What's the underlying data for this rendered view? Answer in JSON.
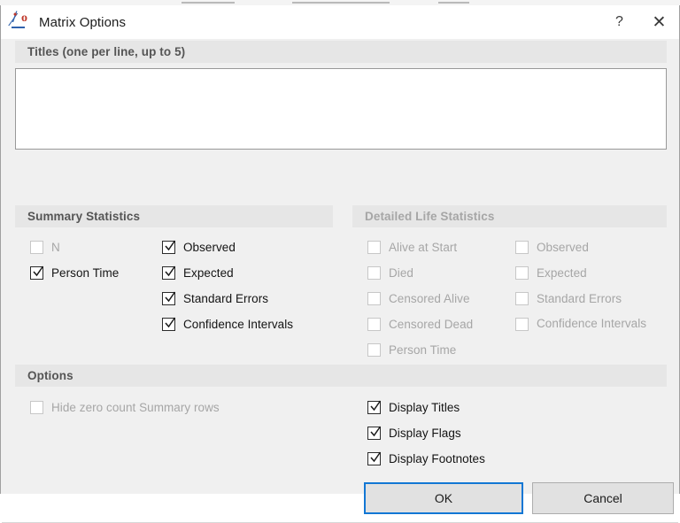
{
  "window": {
    "title": "Matrix Options",
    "icon": "percent-statistics-icon",
    "help_label": "?",
    "close_label": "✕"
  },
  "titles_group": {
    "header": "Titles (one per line, up to 5)",
    "textarea_value": "",
    "textarea_placeholder": ""
  },
  "summary_statistics": {
    "header": "Summary Statistics",
    "left_column": [
      {
        "label": "N",
        "checked": false,
        "disabled": true
      },
      {
        "label": "Person Time",
        "checked": true,
        "disabled": false
      }
    ],
    "right_column": [
      {
        "label": "Observed",
        "checked": true,
        "disabled": false
      },
      {
        "label": "Expected",
        "checked": true,
        "disabled": false
      },
      {
        "label": "Standard Errors",
        "checked": true,
        "disabled": false
      },
      {
        "label": "Confidence Intervals",
        "checked": true,
        "disabled": false
      }
    ]
  },
  "detailed_life_statistics": {
    "header": "Detailed Life Statistics",
    "disabled": true,
    "left_column": [
      {
        "label": "Alive at Start",
        "checked": false,
        "disabled": true
      },
      {
        "label": "Died",
        "checked": false,
        "disabled": true
      },
      {
        "label": "Censored Alive",
        "checked": false,
        "disabled": true
      },
      {
        "label": "Censored Dead",
        "checked": false,
        "disabled": true
      },
      {
        "label": "Person Time",
        "checked": false,
        "disabled": true
      }
    ],
    "right_column": [
      {
        "label": "Observed",
        "checked": false,
        "disabled": true
      },
      {
        "label": "Expected",
        "checked": false,
        "disabled": true
      },
      {
        "label": "Standard Errors",
        "checked": false,
        "disabled": true
      },
      {
        "label": "Confidence Intervals",
        "checked": false,
        "disabled": true,
        "clipped": true
      }
    ]
  },
  "options_group": {
    "header": "Options",
    "left_column": [
      {
        "label": "Hide zero count Summary rows",
        "checked": false,
        "disabled": true
      }
    ],
    "right_column": [
      {
        "label": "Display Titles",
        "checked": true,
        "disabled": false
      },
      {
        "label": "Display Flags",
        "checked": true,
        "disabled": false
      },
      {
        "label": "Display Footnotes",
        "checked": true,
        "disabled": false
      }
    ]
  },
  "footer": {
    "ok_label": "OK",
    "cancel_label": "Cancel"
  },
  "colors": {
    "dialog_bg": "#f0f0f0",
    "group_header_bg": "#e6e6e6",
    "group_header_text": "#555555",
    "disabled_text": "#a6a6a6",
    "focus_border": "#1277d4",
    "button_bg": "#e1e1e1",
    "icon_blue": "#2f62ad",
    "icon_red": "#c0392b"
  }
}
